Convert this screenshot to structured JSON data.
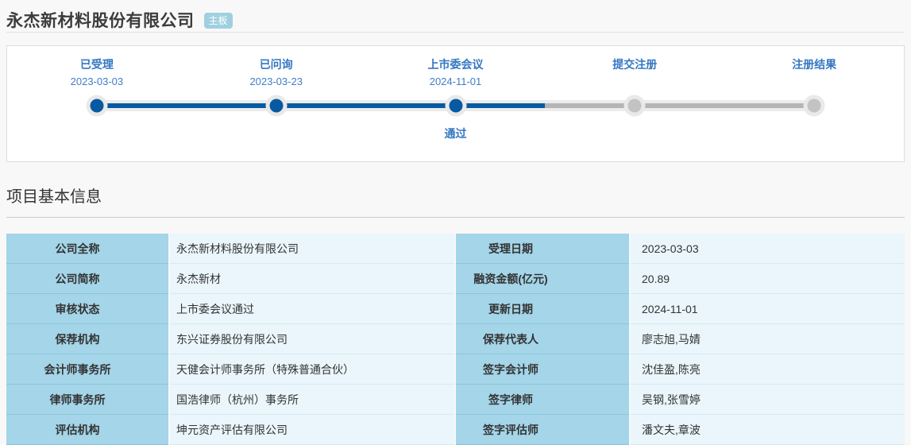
{
  "page": {
    "title": "永杰新材料股份有限公司",
    "board_badge": "主板"
  },
  "timeline": {
    "stages": [
      {
        "label": "已受理",
        "date": "2023-03-03",
        "status": "done",
        "note": ""
      },
      {
        "label": "已问询",
        "date": "2023-03-23",
        "status": "done",
        "note": ""
      },
      {
        "label": "上市委会议",
        "date": "2024-11-01",
        "status": "done",
        "note": "通过"
      },
      {
        "label": "提交注册",
        "date": "",
        "status": "pending",
        "note": ""
      },
      {
        "label": "注册结果",
        "date": "",
        "status": "pending",
        "note": ""
      }
    ],
    "progress_note": "通过"
  },
  "section": {
    "title": "项目基本信息"
  },
  "info_table": {
    "rows": [
      {
        "label_left": "公司全称",
        "value_left": "永杰新材料股份有限公司",
        "label_right": "受理日期",
        "value_right": "2023-03-03"
      },
      {
        "label_left": "公司简称",
        "value_left": "永杰新材",
        "label_right": "融资金额(亿元)",
        "value_right": "20.89"
      },
      {
        "label_left": "审核状态",
        "value_left": "上市委会议通过",
        "label_right": "更新日期",
        "value_right": "2024-11-01"
      },
      {
        "label_left": "保荐机构",
        "value_left": "东兴证券股份有限公司",
        "label_right": "保荐代表人",
        "value_right": "廖志旭,马婧"
      },
      {
        "label_left": "会计师事务所",
        "value_left": "天健会计师事务所（特殊普通合伙）",
        "label_right": "签字会计师",
        "value_right": "沈佳盈,陈亮"
      },
      {
        "label_left": "律师事务所",
        "value_left": "国浩律师（杭州）事务所",
        "label_right": "签字律师",
        "value_right": "吴钢,张雪婷"
      },
      {
        "label_left": "评估机构",
        "value_left": "坤元资产评估有限公司",
        "label_right": "签字评估师",
        "value_right": "潘文夫,章波"
      }
    ]
  },
  "colors": {
    "accent_blue_text": "#3377c2",
    "timeline_done": "#075aa2",
    "timeline_pending": "#b5b5b5",
    "timeline_halo": "#ececec",
    "badge_bg": "#9fd0e0",
    "table_label_bg": "#a4d5e8",
    "table_value_bg": "#eaf6fb",
    "page_bg": "#f8f8f8"
  }
}
